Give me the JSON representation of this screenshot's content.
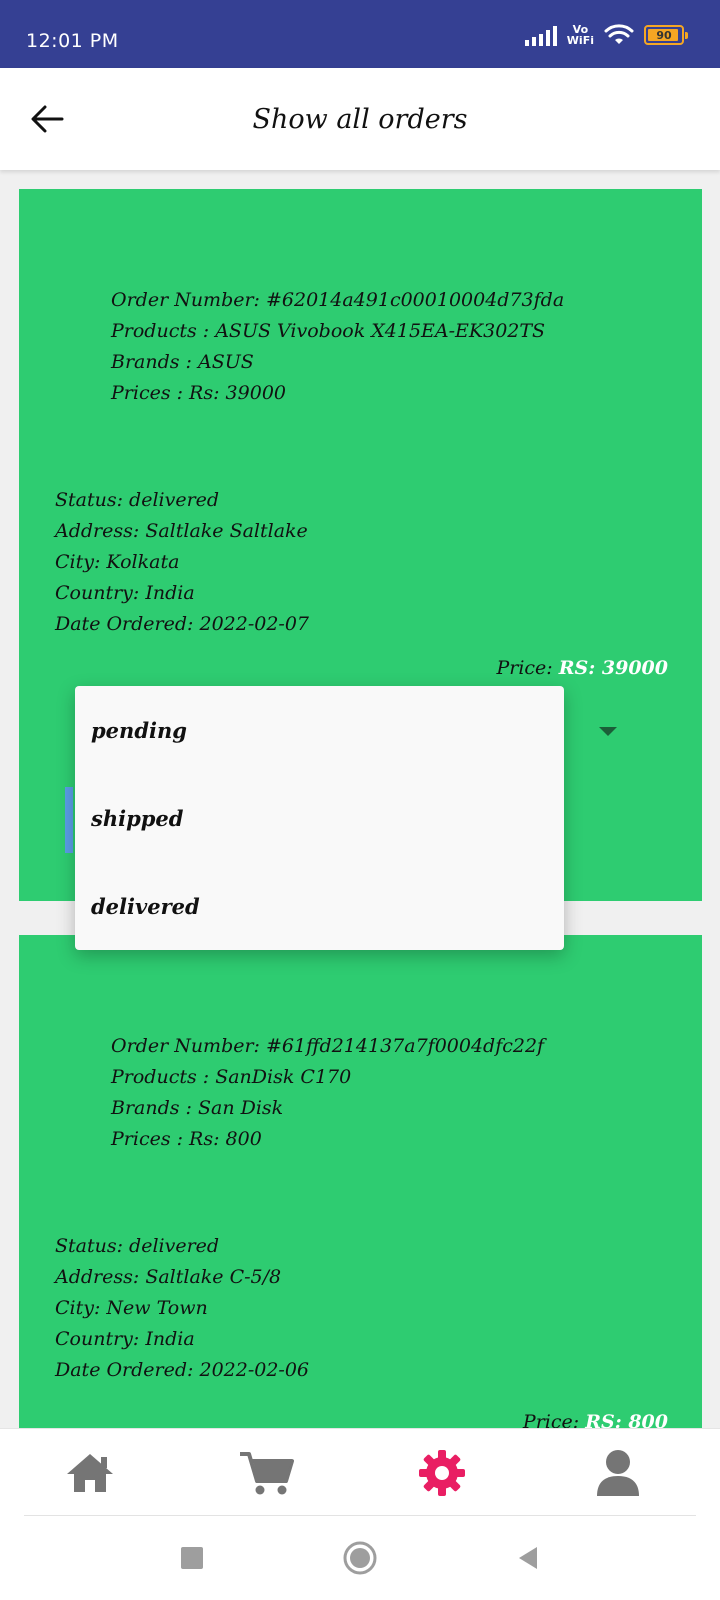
{
  "status_bar": {
    "time": "12:01 PM",
    "network_label_top": "Vo",
    "network_label_bottom": "WiFi",
    "battery": "90",
    "background": "#354093"
  },
  "header": {
    "title": "Show all orders",
    "back_icon": "arrow-left-icon"
  },
  "orders": [
    {
      "order_number": "Order Number: #62014a491c00010004d73fda",
      "products": "Products : ASUS Vivobook X415EA-EK302TS",
      "brands": "Brands : ASUS",
      "prices": "Prices : Rs: 39000",
      "status": "Status: delivered",
      "address": "Address: Saltlake Saltlake",
      "city": "City: Kolkata",
      "country": "Country: India",
      "date": "Date Ordered: 2022-02-07",
      "price_label": "Price:",
      "price_value": "RS: 39000"
    },
    {
      "order_number": "Order Number: #61ffd214137a7f0004dfc22f",
      "products": "Products : SanDisk C170",
      "brands": "Brands : San Disk",
      "prices": "Prices : Rs: 800",
      "status": "Status: delivered",
      "address": "Address: Saltlake C-5/8",
      "city": "City: New Town",
      "country": "Country: India",
      "date": "Date Ordered: 2022-02-06",
      "price_label": "Price:",
      "price_value": "RS: 800"
    }
  ],
  "status_dropdown": {
    "options": [
      "pending",
      "shipped",
      "delivered"
    ]
  },
  "bottom_nav": {
    "items": [
      "home-icon",
      "cart-icon",
      "gear-icon",
      "user-icon"
    ],
    "active_index": 2,
    "active_color": "#e91e63",
    "inactive_color": "#757575"
  },
  "colors": {
    "card": "#2ecc71",
    "page_bg": "#f0f0f0",
    "price_value": "#ffffff"
  }
}
